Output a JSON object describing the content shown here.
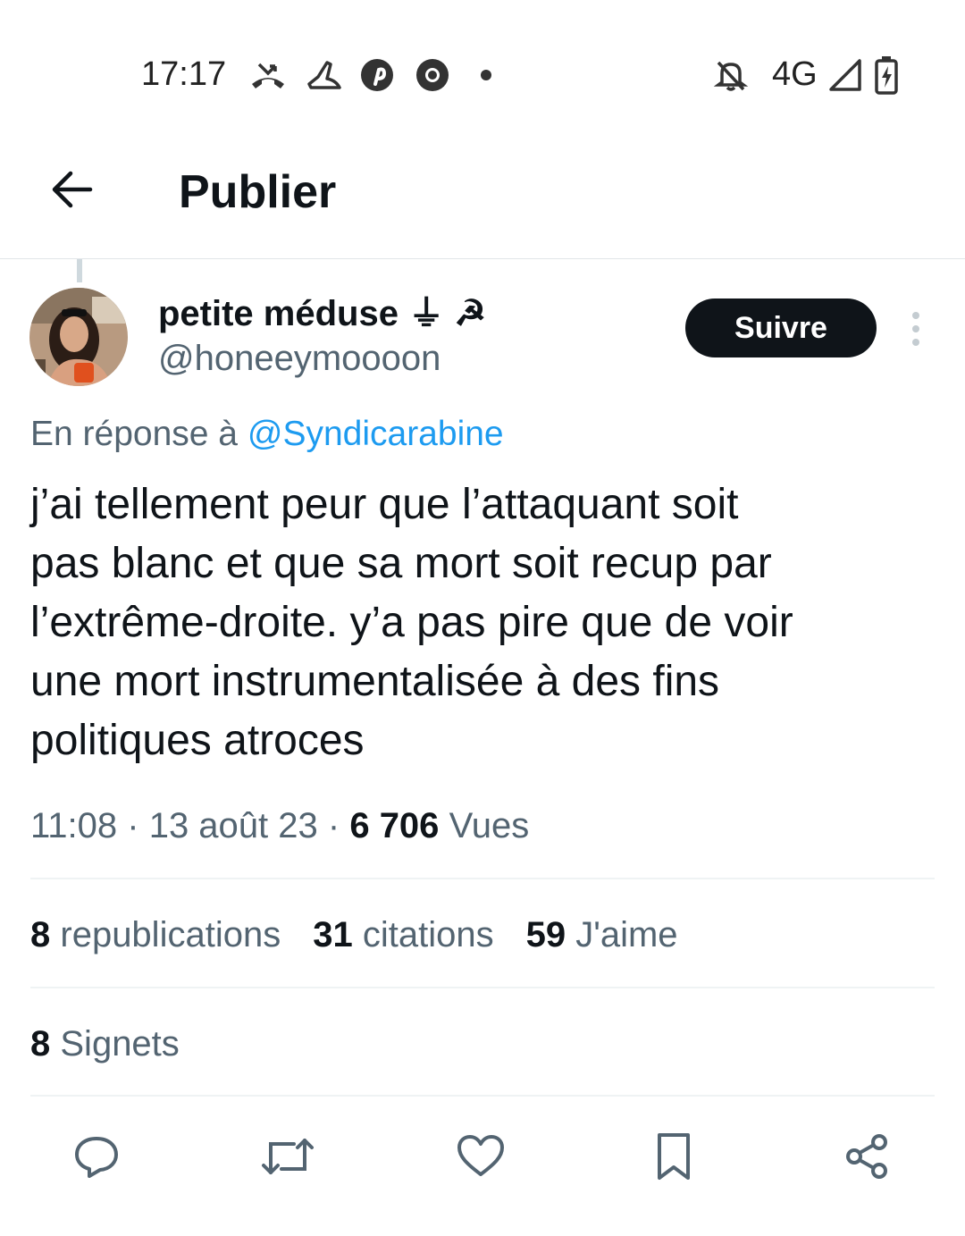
{
  "status_bar": {
    "time": "17:17",
    "notification_icons": [
      "missed-call-icon",
      "shoe-icon",
      "pinterest-icon",
      "chrome-icon",
      "dot-icon"
    ],
    "network": "4G",
    "system_icons": [
      "bell-off-icon",
      "signal-icon",
      "battery-charging-icon"
    ]
  },
  "header": {
    "title": "Publier"
  },
  "post": {
    "author": {
      "name": "petite méduse ⏚ ☭",
      "handle": "@honeeymoooon"
    },
    "follow_label": "Suivre",
    "reply_prefix": "En réponse à",
    "reply_to": "@Syndicarabine",
    "text": "j’ai tellement peur que l’attaquant soit\npas blanc et que sa mort soit recup par\nl’extrême-droite. y’a pas pire que de voir\nune mort instrumentalisée à des fins\npolitiques atroces",
    "time": "11:08",
    "date": "13 août 23",
    "views_count": "6 706",
    "views_label": "Vues",
    "reposts_count": "8",
    "reposts_label": "republications",
    "quotes_count": "31",
    "quotes_label": "citations",
    "likes_count": "59",
    "likes_label": "J'aime",
    "bookmarks_count": "8",
    "bookmarks_label": "Signets"
  },
  "actions": [
    "reply-icon",
    "repost-icon",
    "like-icon",
    "bookmark-icon",
    "share-icon"
  ],
  "colors": {
    "link": "#1d9bf0",
    "secondary_text": "#536471",
    "primary_text": "#0f1419",
    "follow_bg": "#0f1419"
  }
}
